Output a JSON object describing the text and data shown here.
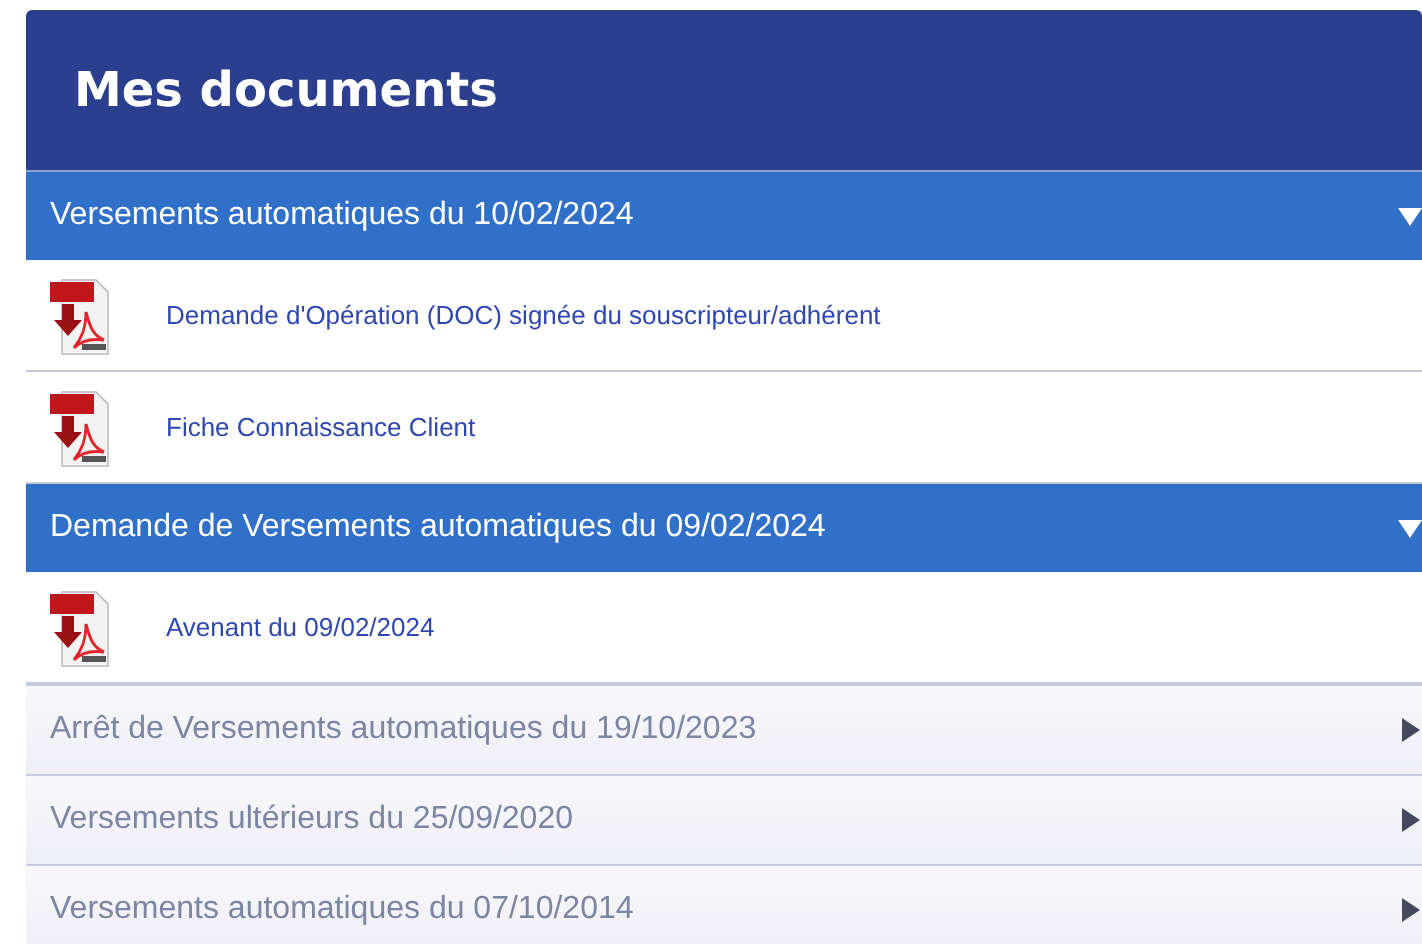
{
  "title": "Mes documents",
  "sections": [
    {
      "label": "Versements automatiques du 10/02/2024",
      "expanded": true,
      "documents": [
        "Demande d'Opération (DOC) signée du souscripteur/adhérent",
        "Fiche Connaissance Client"
      ]
    },
    {
      "label": "Demande de Versements automatiques du 09/02/2024",
      "expanded": true,
      "documents": [
        "Avenant du 09/02/2024"
      ]
    },
    {
      "label": "Arrêt de Versements automatiques du 19/10/2023",
      "expanded": false
    },
    {
      "label": "Versements ultérieurs du 25/09/2020",
      "expanded": false
    },
    {
      "label": "Versements automatiques du 07/10/2014",
      "expanded": false
    }
  ]
}
